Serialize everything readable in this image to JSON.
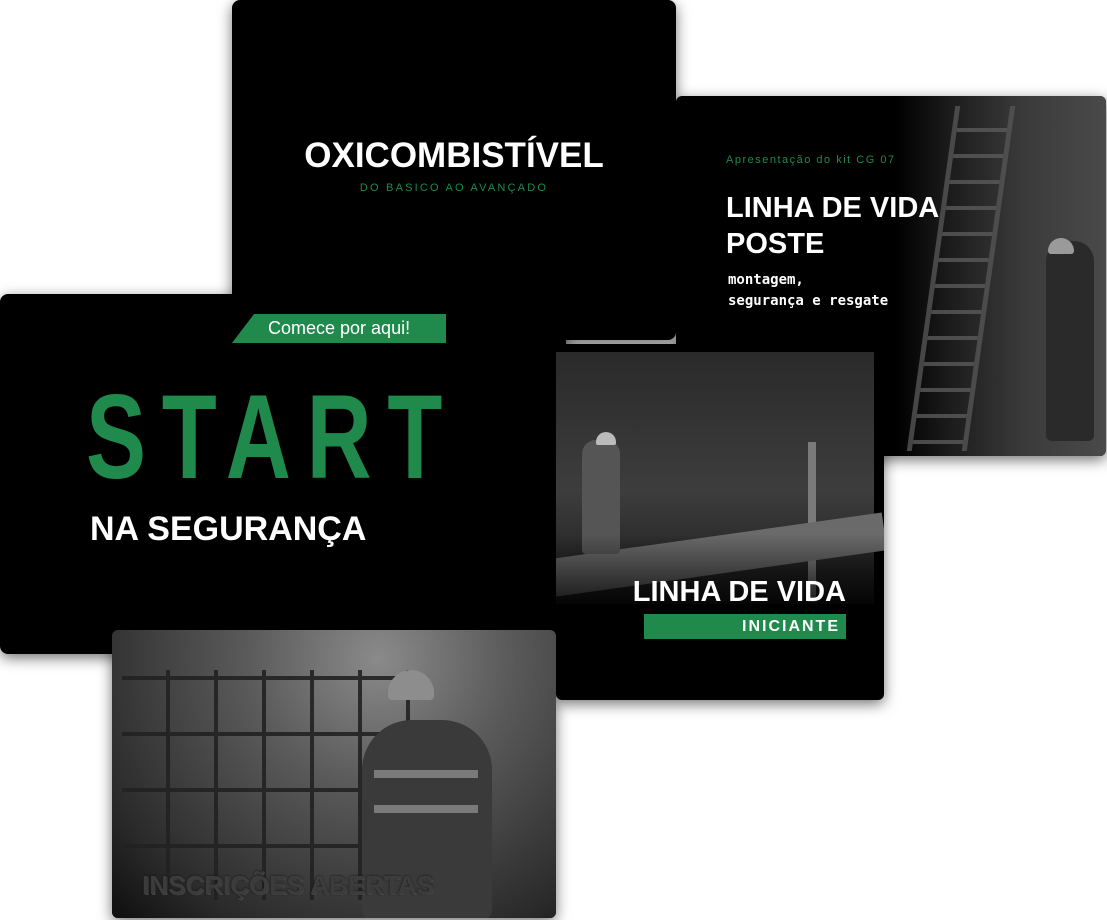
{
  "cards": {
    "oxicombistivel": {
      "title": "OXICOMBISTÍVEL",
      "subtitle": "DO BASICO AO AVANÇADO"
    },
    "linha_vida_poste": {
      "kicker": "Apresentação do kit CG 07",
      "title": "LINHA DE VIDA POSTE",
      "subtitle_line1": "montagem,",
      "subtitle_line2": "segurança e resgate"
    },
    "start": {
      "ribbon": "Comece por aqui!",
      "headline": "START",
      "subheadline": "NA SEGURANÇA"
    },
    "linha_vida_iniciante": {
      "title": "LINHA DE VIDA",
      "badge": "INICIANTE"
    },
    "inscricoes": {
      "label": "INSCRIÇÕES ABERTAS"
    }
  },
  "colors": {
    "accent_green": "#1f8a4c",
    "card_background": "#000000",
    "page_background": "#ffffff"
  }
}
